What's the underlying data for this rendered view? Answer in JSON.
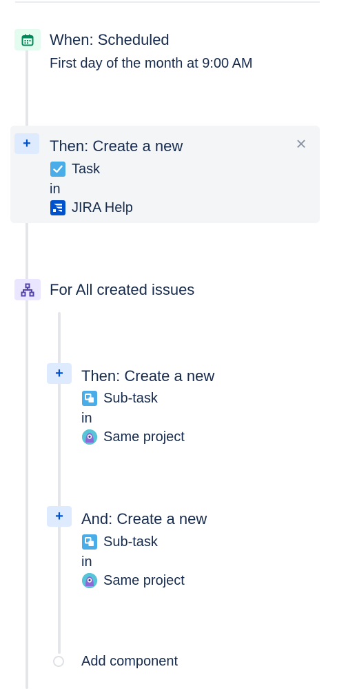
{
  "trigger": {
    "icon": "calendar-icon",
    "title": "When: Scheduled",
    "description": "First day of the month at 9:00 AM"
  },
  "action_main": {
    "icon": "plus-icon",
    "title": "Then: Create a new",
    "issue_type": "Task",
    "connector": "in",
    "project": "JIRA Help",
    "close_icon": "close-icon"
  },
  "branch": {
    "icon": "branch-icon",
    "title": "For All created issues"
  },
  "branch_actions": [
    {
      "icon": "plus-icon",
      "title": "Then: Create a new",
      "issue_type": "Sub-task",
      "connector": "in",
      "project": "Same project"
    },
    {
      "icon": "plus-icon",
      "title": "And: Create a new",
      "issue_type": "Sub-task",
      "connector": "in",
      "project": "Same project"
    }
  ],
  "add_component": {
    "label": "Add component"
  },
  "colors": {
    "trigger_bg": "#e3fcef",
    "trigger_icon": "#00875a",
    "action_bg": "#deebff",
    "action_icon": "#0052cc",
    "branch_bg": "#eae6ff",
    "branch_icon": "#5243aa",
    "text": "#172b4d"
  }
}
